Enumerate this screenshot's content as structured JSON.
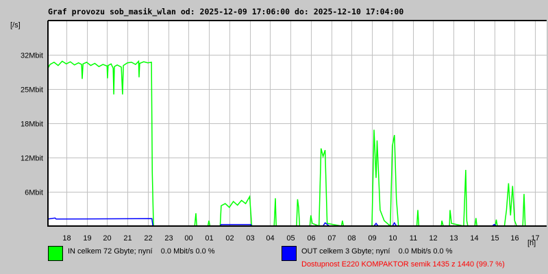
{
  "title": "Graf provozu sob_masik_wlan od: 2025-12-09 17:06:00 do: 2025-12-10 17:04:00",
  "colors": {
    "in": "#00ff00",
    "out": "#0000ff",
    "grid": "#c0c0c0",
    "availability": "#ff0000"
  },
  "legend": {
    "in_text": "IN celkem 72 Gbyte; nyní    0.0 Mbit/s 0.0 %",
    "out_text": "OUT celkem 3 Gbyte; nyní    0.0 Mbit/s 0.0 %",
    "availability": "Dostupnost E220 KOMPAKTOR semik 1435 z 1440 (99.7 %)"
  },
  "chart_data": {
    "type": "line",
    "title": "Graf provozu sob_masik_wlan od: 2025-12-09 17:06:00 do: 2025-12-10 17:04:00",
    "ylabel": "[/s]",
    "xlabel": "[h]",
    "xlim": [
      0,
      24
    ],
    "ylim": [
      0,
      38.4
    ],
    "grid": true,
    "y_ticks": [
      {
        "label": "6Mbit",
        "value": 6.4
      },
      {
        "label": "12Mbit",
        "value": 12.8
      },
      {
        "label": "18Mbit",
        "value": 19.2
      },
      {
        "label": "25Mbit",
        "value": 25.6
      },
      {
        "label": "32Mbit",
        "value": 32
      }
    ],
    "x_ticks": [
      {
        "label": "18",
        "value": 0.9
      },
      {
        "label": "19",
        "value": 1.9
      },
      {
        "label": "20",
        "value": 2.9
      },
      {
        "label": "21",
        "value": 3.9
      },
      {
        "label": "22",
        "value": 4.9
      },
      {
        "label": "23",
        "value": 5.9
      },
      {
        "label": "00",
        "value": 6.9
      },
      {
        "label": "01",
        "value": 7.9
      },
      {
        "label": "02",
        "value": 8.9
      },
      {
        "label": "03",
        "value": 9.9
      },
      {
        "label": "04",
        "value": 10.9
      },
      {
        "label": "05",
        "value": 11.9
      },
      {
        "label": "06",
        "value": 12.9
      },
      {
        "label": "07",
        "value": 13.9
      },
      {
        "label": "08",
        "value": 14.9
      },
      {
        "label": "09",
        "value": 15.9
      },
      {
        "label": "10",
        "value": 16.9
      },
      {
        "label": "11",
        "value": 17.9
      },
      {
        "label": "12",
        "value": 18.9
      },
      {
        "label": "13",
        "value": 19.9
      },
      {
        "label": "14",
        "value": 20.9
      },
      {
        "label": "15",
        "value": 21.9
      },
      {
        "label": "16",
        "value": 22.9
      },
      {
        "label": "17",
        "value": 23.9
      }
    ],
    "series": [
      {
        "name": "IN",
        "unit": "Mbit/s",
        "points": [
          [
            0,
            29.5
          ],
          [
            0.1,
            30.2
          ],
          [
            0.3,
            30.6
          ],
          [
            0.5,
            30.0
          ],
          [
            0.7,
            30.8
          ],
          [
            0.9,
            30.3
          ],
          [
            1.1,
            30.7
          ],
          [
            1.3,
            30.1
          ],
          [
            1.5,
            30.5
          ],
          [
            1.65,
            30.2
          ],
          [
            1.68,
            27.5
          ],
          [
            1.72,
            30.3
          ],
          [
            1.9,
            30.6
          ],
          [
            2.1,
            30.0
          ],
          [
            2.3,
            30.4
          ],
          [
            2.5,
            29.8
          ],
          [
            2.7,
            30.2
          ],
          [
            2.9,
            29.9
          ],
          [
            2.92,
            27.6
          ],
          [
            2.95,
            30.0
          ],
          [
            3.1,
            30.3
          ],
          [
            3.2,
            29.5
          ],
          [
            3.23,
            24.6
          ],
          [
            3.26,
            29.8
          ],
          [
            3.4,
            30.1
          ],
          [
            3.6,
            29.7
          ],
          [
            3.66,
            24.6
          ],
          [
            3.7,
            30.0
          ],
          [
            3.9,
            30.5
          ],
          [
            4.1,
            30.6
          ],
          [
            4.3,
            30.2
          ],
          [
            4.45,
            30.8
          ],
          [
            4.47,
            27.8
          ],
          [
            4.5,
            30.4
          ],
          [
            4.7,
            30.7
          ],
          [
            4.9,
            30.5
          ],
          [
            5.08,
            30.6
          ],
          [
            5.12,
            10
          ],
          [
            5.18,
            0
          ],
          [
            7.2,
            0
          ],
          [
            7.26,
            2.4
          ],
          [
            7.3,
            0
          ],
          [
            7.85,
            0
          ],
          [
            7.9,
            1.0
          ],
          [
            7.95,
            0
          ],
          [
            8.45,
            0
          ],
          [
            8.5,
            3.8
          ],
          [
            8.7,
            4.2
          ],
          [
            8.9,
            3.5
          ],
          [
            9.1,
            4.6
          ],
          [
            9.3,
            3.9
          ],
          [
            9.5,
            4.8
          ],
          [
            9.7,
            4.2
          ],
          [
            9.9,
            5.5
          ],
          [
            10.0,
            0
          ],
          [
            11.1,
            0
          ],
          [
            11.16,
            5.2
          ],
          [
            11.2,
            0
          ],
          [
            12.2,
            0
          ],
          [
            12.25,
            5.0
          ],
          [
            12.3,
            3.5
          ],
          [
            12.35,
            0
          ],
          [
            12.85,
            0
          ],
          [
            12.9,
            2.0
          ],
          [
            12.97,
            0.5
          ],
          [
            13.3,
            0
          ],
          [
            13.4,
            14.5
          ],
          [
            13.5,
            13.0
          ],
          [
            13.6,
            14.2
          ],
          [
            13.7,
            0.5
          ],
          [
            14.4,
            0
          ],
          [
            14.45,
            1.0
          ],
          [
            14.5,
            0
          ],
          [
            15.9,
            0
          ],
          [
            16.0,
            18
          ],
          [
            16.1,
            9
          ],
          [
            16.15,
            16
          ],
          [
            16.3,
            3
          ],
          [
            16.5,
            1
          ],
          [
            16.8,
            0
          ],
          [
            16.9,
            15
          ],
          [
            17.0,
            17
          ],
          [
            17.1,
            5
          ],
          [
            17.2,
            0
          ],
          [
            18.1,
            0
          ],
          [
            18.15,
            3
          ],
          [
            18.2,
            0
          ],
          [
            19.3,
            0
          ],
          [
            19.33,
            1
          ],
          [
            19.4,
            0
          ],
          [
            19.7,
            0
          ],
          [
            19.73,
            3
          ],
          [
            19.8,
            0.5
          ],
          [
            20.4,
            0
          ],
          [
            20.5,
            10.5
          ],
          [
            20.55,
            1
          ],
          [
            20.6,
            0
          ],
          [
            20.95,
            0
          ],
          [
            21.0,
            1.5
          ],
          [
            21.05,
            0
          ],
          [
            21.95,
            0
          ],
          [
            22.0,
            1.2
          ],
          [
            22.05,
            0
          ],
          [
            22.4,
            0
          ],
          [
            22.5,
            3
          ],
          [
            22.6,
            8
          ],
          [
            22.7,
            2
          ],
          [
            22.8,
            7.5
          ],
          [
            22.9,
            1
          ],
          [
            23.0,
            0
          ],
          [
            23.3,
            0
          ],
          [
            23.36,
            6
          ],
          [
            23.42,
            0
          ]
        ]
      },
      {
        "name": "OUT",
        "unit": "Mbit/s",
        "points": [
          [
            0,
            1.3
          ],
          [
            0.35,
            1.5
          ],
          [
            0.4,
            1.3
          ],
          [
            5.1,
            1.4
          ],
          [
            5.15,
            0
          ],
          [
            8.45,
            0
          ],
          [
            8.5,
            0.3
          ],
          [
            9.95,
            0.3
          ],
          [
            10,
            0
          ],
          [
            13.5,
            0
          ],
          [
            13.6,
            0.6
          ],
          [
            13.8,
            0
          ],
          [
            16.0,
            0
          ],
          [
            16.1,
            0.5
          ],
          [
            16.2,
            0
          ],
          [
            16.9,
            0
          ],
          [
            17.0,
            0.6
          ],
          [
            17.1,
            0
          ],
          [
            21.8,
            0
          ],
          [
            21.9,
            0.3
          ],
          [
            22.0,
            0
          ]
        ]
      }
    ]
  }
}
